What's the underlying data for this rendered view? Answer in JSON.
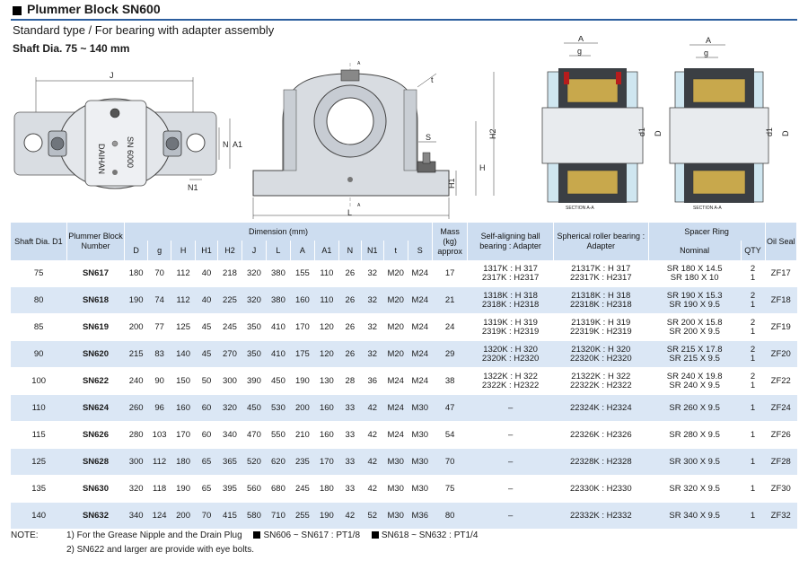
{
  "header": {
    "title": "Plummer Block SN600",
    "subtitle": "Standard type / For bearing with adapter assembly",
    "shaft_range": "Shaft Dia. 75 ~ 140 mm"
  },
  "drawings": {
    "top_view": {
      "labels": [
        "J",
        "A1",
        "N1",
        "N"
      ],
      "body_text_1": "DAIHAN",
      "body_text_2": "SN 6000"
    },
    "front_view": {
      "labels": [
        "A",
        "A",
        "t",
        "H2",
        "S",
        "H",
        "H1",
        "L"
      ]
    },
    "section_left": {
      "labels": [
        "A",
        "g",
        "d1",
        "D"
      ],
      "caption": "SECTION A-A"
    },
    "section_right": {
      "labels": [
        "A",
        "g",
        "d1",
        "D"
      ],
      "caption": "SECTION A-A"
    }
  },
  "table": {
    "headers": {
      "shaft": "Shaft Dia. D1",
      "plummer": "Plummer Block Number",
      "dimension": "Dimension (mm)",
      "mass": "Mass (kg) approx",
      "self_align": "Self-aligning ball bearing : Adapter",
      "spherical": "Spherical roller bearing : Adapter",
      "spacer": "Spacer Ring",
      "nominal": "Nominal",
      "qty": "QTY",
      "oil": "Oil Seal",
      "dims": [
        "D",
        "g",
        "H",
        "H1",
        "H2",
        "J",
        "L",
        "A",
        "A1",
        "N",
        "N1",
        "t",
        "S"
      ]
    },
    "rows": [
      {
        "shaft": "75",
        "block": "SN617",
        "dims": [
          "180",
          "70",
          "112",
          "40",
          "218",
          "320",
          "380",
          "155",
          "110",
          "26",
          "32",
          "M20",
          "M24"
        ],
        "mass": "17",
        "self": [
          "1317K : H 317",
          "2317K : H2317"
        ],
        "sph": [
          "21317K : H 317",
          "22317K : H2317"
        ],
        "nominal": [
          "SR 180 X 14.5",
          "SR 180 X 10"
        ],
        "qty": [
          "2",
          "1"
        ],
        "seal": "ZF17"
      },
      {
        "shaft": "80",
        "block": "SN618",
        "dims": [
          "190",
          "74",
          "112",
          "40",
          "225",
          "320",
          "380",
          "160",
          "110",
          "26",
          "32",
          "M20",
          "M24"
        ],
        "mass": "21",
        "self": [
          "1318K : H 318",
          "2318K : H2318"
        ],
        "sph": [
          "21318K : H 318",
          "22318K : H2318"
        ],
        "nominal": [
          "SR 190 X 15.3",
          "SR 190 X 9.5"
        ],
        "qty": [
          "2",
          "1"
        ],
        "seal": "ZF18"
      },
      {
        "shaft": "85",
        "block": "SN619",
        "dims": [
          "200",
          "77",
          "125",
          "45",
          "245",
          "350",
          "410",
          "170",
          "120",
          "26",
          "32",
          "M20",
          "M24"
        ],
        "mass": "24",
        "self": [
          "1319K : H 319",
          "2319K : H2319"
        ],
        "sph": [
          "21319K : H 319",
          "22319K : H2319"
        ],
        "nominal": [
          "SR 200 X 15.8",
          "SR 200 X 9.5"
        ],
        "qty": [
          "2",
          "1"
        ],
        "seal": "ZF19"
      },
      {
        "shaft": "90",
        "block": "SN620",
        "dims": [
          "215",
          "83",
          "140",
          "45",
          "270",
          "350",
          "410",
          "175",
          "120",
          "26",
          "32",
          "M20",
          "M24"
        ],
        "mass": "29",
        "self": [
          "1320K : H 320",
          "2320K : H2320"
        ],
        "sph": [
          "21320K : H 320",
          "22320K : H2320"
        ],
        "nominal": [
          "SR 215 X 17.8",
          "SR 215 X 9.5"
        ],
        "qty": [
          "2",
          "1"
        ],
        "seal": "ZF20"
      },
      {
        "shaft": "100",
        "block": "SN622",
        "dims": [
          "240",
          "90",
          "150",
          "50",
          "300",
          "390",
          "450",
          "190",
          "130",
          "28",
          "36",
          "M24",
          "M24"
        ],
        "mass": "38",
        "self": [
          "1322K : H 322",
          "2322K : H2322"
        ],
        "sph": [
          "21322K : H 322",
          "22322K : H2322"
        ],
        "nominal": [
          "SR 240 X 19.8",
          "SR 240 X 9.5"
        ],
        "qty": [
          "2",
          "1"
        ],
        "seal": "ZF22"
      },
      {
        "shaft": "110",
        "block": "SN624",
        "dims": [
          "260",
          "96",
          "160",
          "60",
          "320",
          "450",
          "530",
          "200",
          "160",
          "33",
          "42",
          "M24",
          "M30"
        ],
        "mass": "47",
        "self": [
          "–"
        ],
        "sph": [
          "22324K : H2324"
        ],
        "nominal": [
          "SR 260 X 9.5"
        ],
        "qty": [
          "1"
        ],
        "seal": "ZF24"
      },
      {
        "shaft": "115",
        "block": "SN626",
        "dims": [
          "280",
          "103",
          "170",
          "60",
          "340",
          "470",
          "550",
          "210",
          "160",
          "33",
          "42",
          "M24",
          "M30"
        ],
        "mass": "54",
        "self": [
          "–"
        ],
        "sph": [
          "22326K : H2326"
        ],
        "nominal": [
          "SR 280 X 9.5"
        ],
        "qty": [
          "1"
        ],
        "seal": "ZF26"
      },
      {
        "shaft": "125",
        "block": "SN628",
        "dims": [
          "300",
          "112",
          "180",
          "65",
          "365",
          "520",
          "620",
          "235",
          "170",
          "33",
          "42",
          "M30",
          "M30"
        ],
        "mass": "70",
        "self": [
          "–"
        ],
        "sph": [
          "22328K : H2328"
        ],
        "nominal": [
          "SR 300 X 9.5"
        ],
        "qty": [
          "1"
        ],
        "seal": "ZF28"
      },
      {
        "shaft": "135",
        "block": "SN630",
        "dims": [
          "320",
          "118",
          "190",
          "65",
          "395",
          "560",
          "680",
          "245",
          "180",
          "33",
          "42",
          "M30",
          "M30"
        ],
        "mass": "75",
        "self": [
          "–"
        ],
        "sph": [
          "22330K : H2330"
        ],
        "nominal": [
          "SR 320 X 9.5"
        ],
        "qty": [
          "1"
        ],
        "seal": "ZF30"
      },
      {
        "shaft": "140",
        "block": "SN632",
        "dims": [
          "340",
          "124",
          "200",
          "70",
          "415",
          "580",
          "710",
          "255",
          "190",
          "42",
          "52",
          "M30",
          "M36"
        ],
        "mass": "80",
        "self": [
          "–"
        ],
        "sph": [
          "22332K : H2332"
        ],
        "nominal": [
          "SR 340 X 9.5"
        ],
        "qty": [
          "1"
        ],
        "seal": "ZF32"
      }
    ]
  },
  "notes": {
    "label": "NOTE:",
    "note1_a": "1) For the Grease Nipple and the Drain Plug",
    "note1_b": "SN606 ~ SN617 : PT1/8",
    "note1_c": "SN618 ~ SN632 : PT1/4",
    "note2": "2) SN622 and larger are provide with  eye bolts."
  }
}
